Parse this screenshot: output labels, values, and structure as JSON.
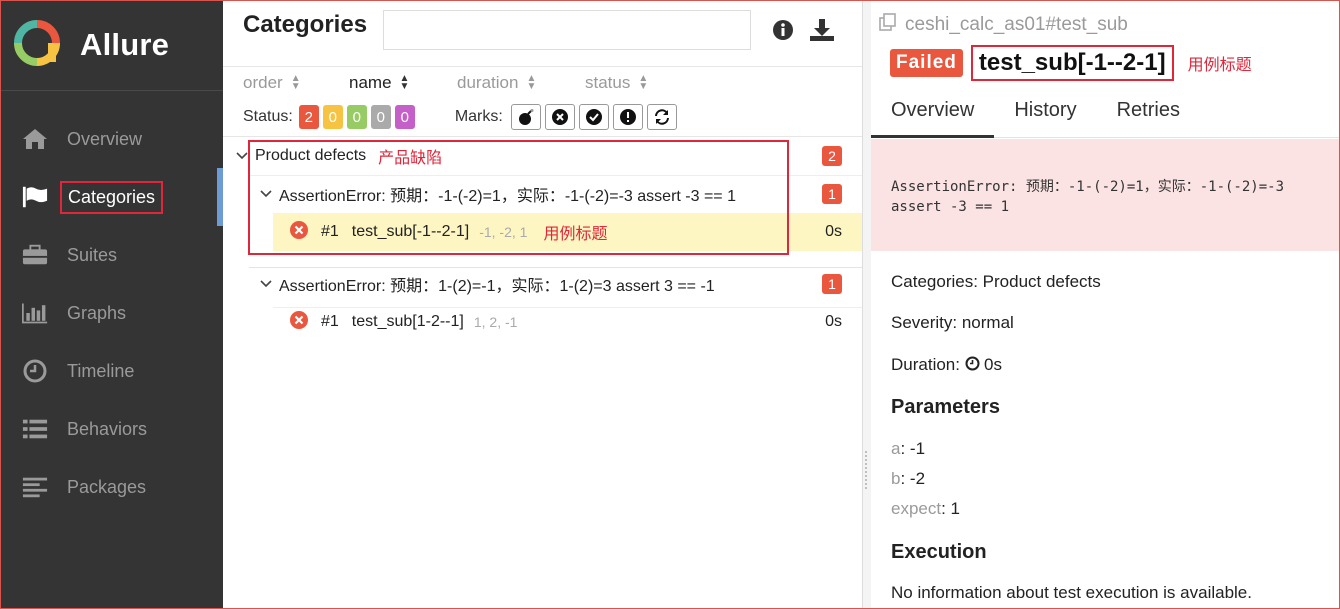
{
  "sidebar": {
    "brand": "Allure",
    "items": [
      {
        "label": "Overview",
        "icon": "home-icon"
      },
      {
        "label": "Categories",
        "icon": "flag-icon",
        "active": true
      },
      {
        "label": "Suites",
        "icon": "briefcase-icon"
      },
      {
        "label": "Graphs",
        "icon": "bar-chart-icon"
      },
      {
        "label": "Timeline",
        "icon": "clock-icon"
      },
      {
        "label": "Behaviors",
        "icon": "list-icon"
      },
      {
        "label": "Packages",
        "icon": "align-left-icon"
      }
    ]
  },
  "categories": {
    "title": "Categories",
    "search": {
      "value": "",
      "placeholder": ""
    },
    "sort": {
      "order": "order",
      "name": "name",
      "duration": "duration",
      "status": "status"
    },
    "status_label": "Status:",
    "status_counts": [
      {
        "value": "2",
        "color": "#e9573f"
      },
      {
        "value": "0",
        "color": "#f6c343"
      },
      {
        "value": "0",
        "color": "#97cc64"
      },
      {
        "value": "0",
        "color": "#aaaaaa"
      },
      {
        "value": "0",
        "color": "#c560c9"
      }
    ],
    "marks_label": "Marks:",
    "tree": {
      "group": {
        "name": "Product defects",
        "annotation": "产品缺陷",
        "count": "2"
      },
      "sub1": {
        "name": "AssertionError: 预期：-1-(-2)=1，实际：-1-(-2)=-3 assert -3 == 1",
        "count": "1"
      },
      "leaf1": {
        "num": "#1",
        "name": "test_sub[-1--2-1]",
        "params": "-1, -2, 1",
        "annotation": "用例标题",
        "duration": "0s"
      },
      "sub2": {
        "name": "AssertionError: 预期：1-(2)=-1，实际：1-(2)=3 assert 3 == -1",
        "count": "1"
      },
      "leaf2": {
        "num": "#1",
        "name": "test_sub[1-2--1]",
        "params": "1, 2, -1",
        "duration": "0s"
      }
    }
  },
  "detail": {
    "breadcrumb": "ceshi_calc_as01#test_sub",
    "status": "Failed",
    "title": "test_sub[-1--2-1]",
    "title_annotation": "用例标题",
    "tabs": [
      "Overview",
      "History",
      "Retries"
    ],
    "error_line1": "AssertionError: 预期：-1-(-2)=1，实际：-1-(-2)=-3",
    "error_line2": "assert -3 == 1",
    "categories_line": "Categories: Product defects",
    "severity_line": "Severity: normal",
    "duration_label": "Duration:",
    "duration_value": "0s",
    "parameters_title": "Parameters",
    "params": [
      {
        "key": "a",
        "value": "-1"
      },
      {
        "key": "b",
        "value": "-2"
      },
      {
        "key": "expect",
        "value": "1"
      }
    ],
    "execution_title": "Execution",
    "execution_text": "No information about test execution is available."
  }
}
